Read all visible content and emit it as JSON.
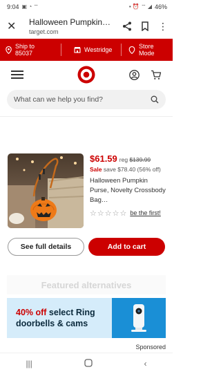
{
  "status_bar": {
    "time": "9:04",
    "battery": "46%"
  },
  "browser": {
    "title": "Halloween Pumpkin…",
    "url": "target.com"
  },
  "store_bar": {
    "ship_label": "Ship to",
    "ship_zip": "85037",
    "store_name": "Westridge",
    "mode_line1": "Store",
    "mode_line2": "Mode"
  },
  "search": {
    "placeholder": "What can we help you find?"
  },
  "product": {
    "price": "$61.59",
    "reg_prefix": "reg",
    "reg_price": "$139.99",
    "sale_label": "Sale",
    "save_text": "save $78.40 (56% off)",
    "name": "Halloween Pumpkin Purse, Novelty Crossbody Bag…",
    "stars": "☆☆☆☆☆",
    "review_link": "be the first!"
  },
  "buttons": {
    "details": "See full details",
    "cart": "Add to cart"
  },
  "featured": {
    "title": "Featured alternatives"
  },
  "ad": {
    "off": "40% off",
    "line1_rest": " select Ring",
    "line2": "doorbells & cams"
  },
  "sponsored": "Sponsored",
  "colors": {
    "brand_red": "#cc0000",
    "ad_bg": "#d5ecfa",
    "ad_camera_bg": "#1a8fd6"
  }
}
